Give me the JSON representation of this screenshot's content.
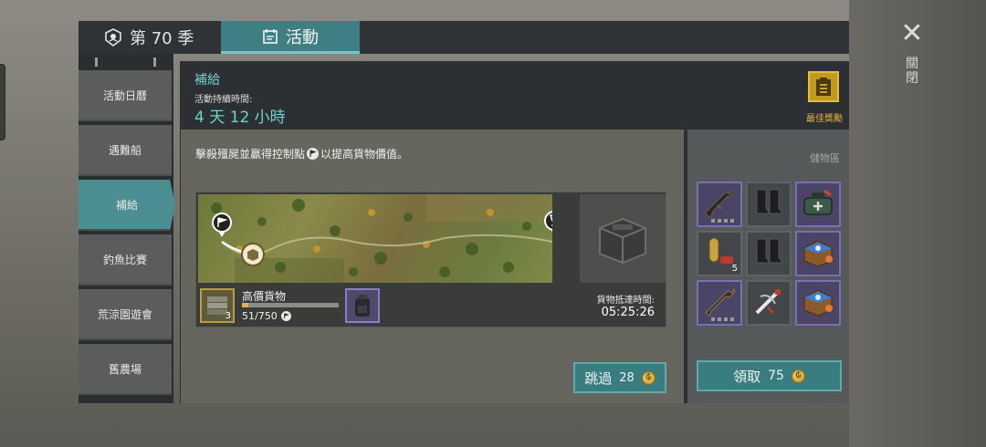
{
  "tabs": {
    "season_label": "第 70 季",
    "events_label": "活動"
  },
  "close_label": "關閉",
  "sidebar": {
    "items": [
      {
        "label": "活動日曆"
      },
      {
        "label": "遇難船"
      },
      {
        "label": "補給"
      },
      {
        "label": "釣魚比賽"
      },
      {
        "label": "荒涼園遊會"
      },
      {
        "label": "舊農場"
      }
    ],
    "active_index": 2
  },
  "header": {
    "title": "補給",
    "duration_label": "活動持續時間:",
    "duration_value": "4 天 12 小時",
    "best_reward_label": "最佳獎勵"
  },
  "content": {
    "description_pre": "擊殺殭屍並贏得控制點",
    "description_post": "以提高貨物價值。",
    "cargo": {
      "name": "高價貨物",
      "count": "3",
      "progress_text": "51/750",
      "progress_current": 51,
      "progress_max": 750
    },
    "arrival_label": "貨物抵達時間:",
    "arrival_time": "05:25:26",
    "skip": {
      "label": "跳過",
      "cost": "28"
    }
  },
  "storage": {
    "label": "儲物區",
    "slots": [
      {
        "icon": "assault-rifle-icon",
        "rarity": "purple"
      },
      {
        "icon": "boots-icon",
        "rarity": "gray"
      },
      {
        "icon": "medkit-bag-icon",
        "rarity": "purple"
      },
      {
        "icon": "ammo-icon",
        "rarity": "gray",
        "count": "5"
      },
      {
        "icon": "boots-icon",
        "rarity": "gray"
      },
      {
        "icon": "blueprint-chest-icon",
        "rarity": "purple"
      },
      {
        "icon": "rifle-icon",
        "rarity": "purple"
      },
      {
        "icon": "crossbow-icon",
        "rarity": "gray"
      },
      {
        "icon": "blueprint-chest-icon",
        "rarity": "purple"
      }
    ],
    "claim": {
      "label": "領取",
      "cost": "75"
    }
  },
  "colors": {
    "accent_teal": "#3f7f83",
    "highlight_text": "#6fd0d0",
    "gold": "#e0b33c",
    "rare_purple": "#7a6fb0"
  }
}
